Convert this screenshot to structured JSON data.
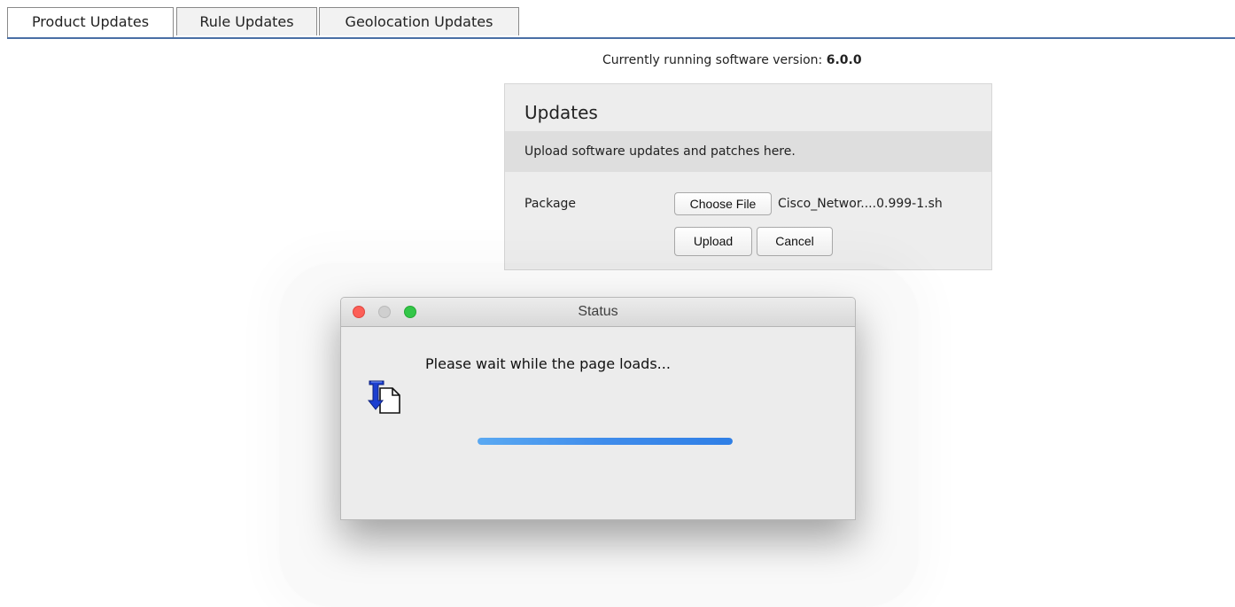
{
  "tabs": [
    {
      "label": "Product Updates",
      "active": true
    },
    {
      "label": "Rule Updates",
      "active": false
    },
    {
      "label": "Geolocation Updates",
      "active": false
    }
  ],
  "version": {
    "prefix": "Currently running software version: ",
    "value": "6.0.0"
  },
  "updates_panel": {
    "title": "Updates",
    "description": "Upload software updates and patches here.",
    "package_label": "Package",
    "choose_file_label": "Choose File",
    "file_name": "Cisco_Networ....0.999-1.sh",
    "upload_label": "Upload",
    "cancel_label": "Cancel"
  },
  "status_dialog": {
    "title": "Status",
    "message": "Please wait while the page loads...",
    "progress": 1.0,
    "icon": "document-download-icon",
    "colors": {
      "close": "#fc5f57",
      "minimize": "#cfcfcf",
      "zoom": "#33c648",
      "progress": "#3f8ceb"
    }
  },
  "colors": {
    "tab_underline": "#4a6fa5"
  }
}
